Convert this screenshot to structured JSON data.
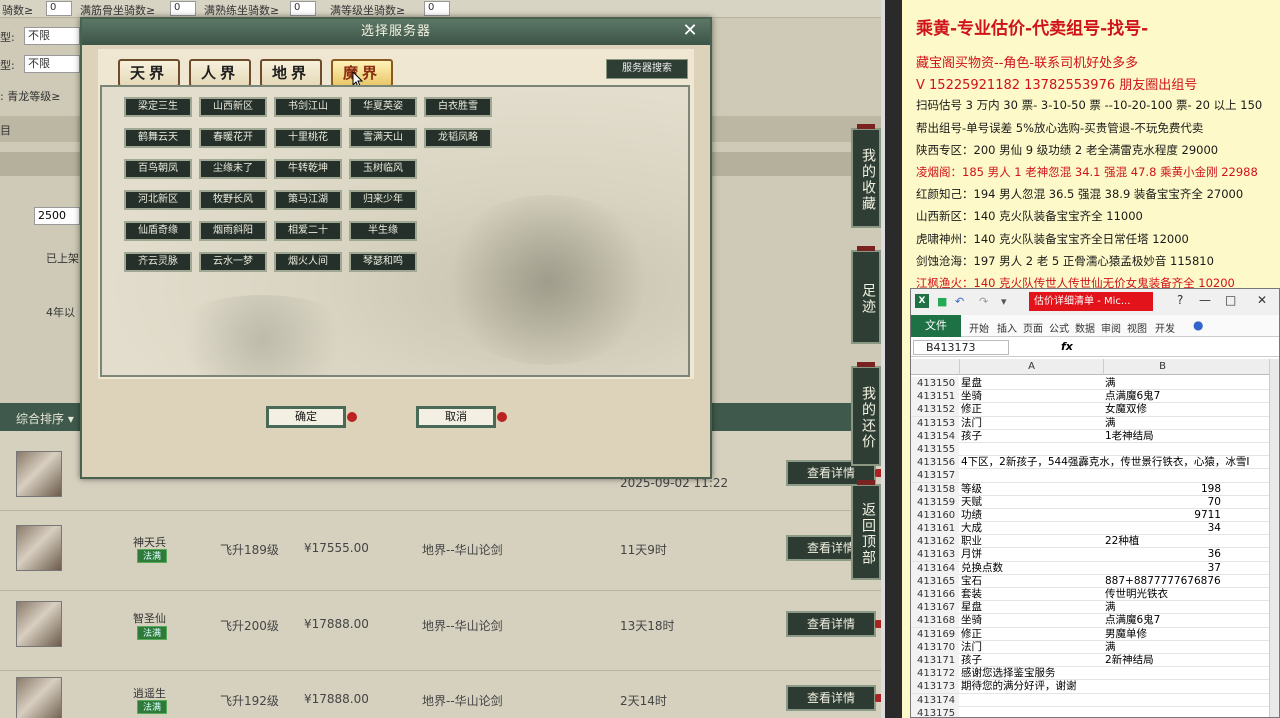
{
  "background": {
    "filters_top": [
      {
        "label": "骑数≥",
        "value": "0"
      },
      {
        "label": "满筋骨坐骑数≥",
        "value": "0"
      },
      {
        "label": "满熟练坐骑数≥",
        "value": "0"
      },
      {
        "label": "满等级坐骑数≥",
        "value": "0"
      }
    ],
    "side_labels": [
      "型:",
      "型:"
    ],
    "selects": [
      "不限",
      "不限"
    ],
    "side_text_1": ": 青龙等级≥",
    "side_text_2": "目",
    "price_input": "2500",
    "side_text_3": "已上架",
    "side_text_4": "4年以",
    "sort_label": "综合排序 ▾",
    "rows": [
      {
        "name": "",
        "badge": "",
        "level": "",
        "price": "",
        "server": "",
        "time": "2025-09-02 11:22",
        "detail": "查看详情"
      },
      {
        "name": "神天兵",
        "badge": "法满",
        "level": "飞升189级",
        "price": "¥17555.00",
        "server": "地界--华山论剑",
        "time": "11天9时",
        "detail": "查看详情"
      },
      {
        "name": "智圣仙",
        "badge": "法满",
        "level": "飞升200级",
        "price": "¥17888.00",
        "server": "地界--华山论剑",
        "time": "13天18时",
        "detail": "查看详情"
      },
      {
        "name": "逍遥生",
        "badge": "法满",
        "level": "飞升192级",
        "price": "¥17888.00",
        "server": "地界--华山论剑",
        "time": "2天14时",
        "detail": "查看详情"
      }
    ],
    "side_buttons": [
      "我的收藏",
      "足迹",
      "我的还价",
      "返回顶部"
    ]
  },
  "dialog": {
    "title": "选择服务器",
    "close": "✕",
    "tabs": [
      "天界",
      "人界",
      "地界",
      "魔界"
    ],
    "active_tab": 3,
    "search_button": "服务器搜索",
    "servers": [
      [
        "梁定三生",
        "山西新区",
        "书剑江山",
        "华夏英姿",
        "白衣胜雪"
      ],
      [
        "鹤舞云天",
        "春暖花开",
        "十里桃花",
        "雪满天山",
        "龙韬凤略"
      ],
      [
        "百鸟朝凤",
        "尘缘未了",
        "牛转乾坤",
        "玉树临风"
      ],
      [
        "河北新区",
        "牧野长风",
        "策马江湖",
        "归来少年"
      ],
      [
        "仙盾奇缘",
        "烟雨斜阳",
        "相爱二十",
        "半生缘"
      ],
      [
        "齐云灵脉",
        "云水一梦",
        "烟火人间",
        "琴瑟和鸣"
      ]
    ],
    "confirm": "确定",
    "cancel": "取消"
  },
  "info_panel": {
    "headline": "乘黄-专业估价-代卖组号-找号-",
    "lines": [
      {
        "text": "藏宝阁买物资--角色-联系司机好处多多",
        "style": "red"
      },
      {
        "text": "V 15225921182      13782553976 朋友圈出组号",
        "style": "red"
      },
      {
        "text": "扫码估号 3 万内 30 票- 3-10-50 票  --10-20-100 票- 20 以上 150",
        "style": "normal"
      },
      {
        "text": "帮出组号-单号误差 5%放心选购-买贵管退-不玩免费代卖",
        "style": "normal"
      },
      {
        "text": "陕西专区：200 男仙 9 级功绩 2 老全满雷克水程度 29000",
        "style": "normal"
      },
      {
        "text": "凌烟阁：185 男人 1 老神忽混 34.1 强混 47.8 乘黄小金刚 22988",
        "style": "redsm"
      },
      {
        "text": "红颜知己：194 男人忽混 36.5 强混 38.9 装备宝宝齐全 27000",
        "style": "normal"
      },
      {
        "text": "山西新区：140 克火队装备宝宝齐全 11000",
        "style": "normal"
      },
      {
        "text": "虎啸神州：140 克火队装备宝宝齐全日常任塔 12000",
        "style": "normal"
      },
      {
        "text": "剑蚀沧海：197 男人 2 老 5 正骨濡心猿孟极妙音 115810",
        "style": "normal"
      },
      {
        "text": "江枫渔火：140 克火队传世人传世仙无价女鬼装备齐全 10200",
        "style": "redsm"
      }
    ]
  },
  "excel": {
    "doc_title": "估价详细清单 - Mic...",
    "ribbon_file": "文件",
    "ribbon_tabs": [
      "开始",
      "插入",
      "页面",
      "公式",
      "数据",
      "审阅",
      "视图",
      "开发"
    ],
    "name_box": "B413173",
    "fx": "fx",
    "col_a": "A",
    "col_b": "B",
    "rows": [
      {
        "n": "413150",
        "a": "星盘",
        "b": "满"
      },
      {
        "n": "413151",
        "a": "坐骑",
        "b": "点满魔6鬼7"
      },
      {
        "n": "413152",
        "a": "修正",
        "b": "女魔双修"
      },
      {
        "n": "413153",
        "a": "法门",
        "b": "满"
      },
      {
        "n": "413154",
        "a": "孩子",
        "b": "1老神结局"
      },
      {
        "n": "413155",
        "a": "",
        "b": ""
      },
      {
        "n": "413156",
        "a": "4下区，2新孩子，544强霹克水，传世景行铁衣，心猿，冰雪I",
        "b": ""
      },
      {
        "n": "413157",
        "a": "",
        "b": ""
      },
      {
        "n": "413158",
        "a": "等级",
        "bn": "198"
      },
      {
        "n": "413159",
        "a": "天赋",
        "bn": "70"
      },
      {
        "n": "413160",
        "a": "功绩",
        "bn": "9711"
      },
      {
        "n": "413161",
        "a": "大成",
        "bn": "34"
      },
      {
        "n": "413162",
        "a": "职业",
        "b": "22种植"
      },
      {
        "n": "413163",
        "a": "月饼",
        "bn": "36"
      },
      {
        "n": "413164",
        "a": "兑换点数",
        "bn": "37"
      },
      {
        "n": "413165",
        "a": "宝石",
        "b": "887+8877777676876"
      },
      {
        "n": "413166",
        "a": "套装",
        "b": "传世明光铁衣"
      },
      {
        "n": "413167",
        "a": "星盘",
        "b": "满"
      },
      {
        "n": "413168",
        "a": "坐骑",
        "b": "点满魔6鬼7"
      },
      {
        "n": "413169",
        "a": "修正",
        "b": "男魔单修"
      },
      {
        "n": "413170",
        "a": "法门",
        "b": "满"
      },
      {
        "n": "413171",
        "a": "孩子",
        "b": "2新神结局"
      },
      {
        "n": "413172",
        "a": "感谢您选择鉴宝服务",
        "b": ""
      },
      {
        "n": "413173",
        "a": "期待您的满分好评，谢谢",
        "b": ""
      },
      {
        "n": "413174",
        "a": "",
        "b": ""
      },
      {
        "n": "413175",
        "a": "",
        "b": ""
      }
    ]
  }
}
